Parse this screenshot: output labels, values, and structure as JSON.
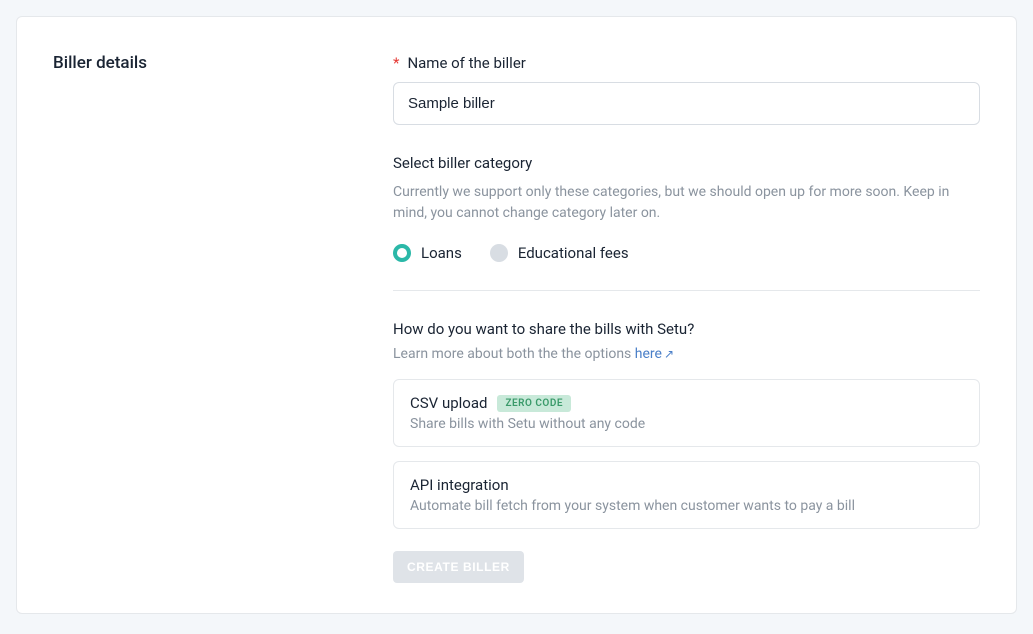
{
  "section_title": "Biller details",
  "name_field": {
    "label": "Name of the biller",
    "value": "Sample biller"
  },
  "category": {
    "label": "Select biller category",
    "helper": "Currently we support only these categories, but we should open up for more soon. Keep in mind, you cannot change category later on.",
    "options": [
      "Loans",
      "Educational fees"
    ],
    "selected_index": 0
  },
  "share": {
    "label": "How do you want to share the bills with Setu?",
    "helper_prefix": "Learn more about both the the options ",
    "helper_link": "here",
    "options": [
      {
        "title": "CSV upload",
        "badge": "ZERO CODE",
        "desc": "Share bills with Setu without any code"
      },
      {
        "title": "API integration",
        "badge": null,
        "desc": "Automate bill fetch from your system when customer wants to pay a bill"
      }
    ]
  },
  "create_button": "CREATE BILLER"
}
